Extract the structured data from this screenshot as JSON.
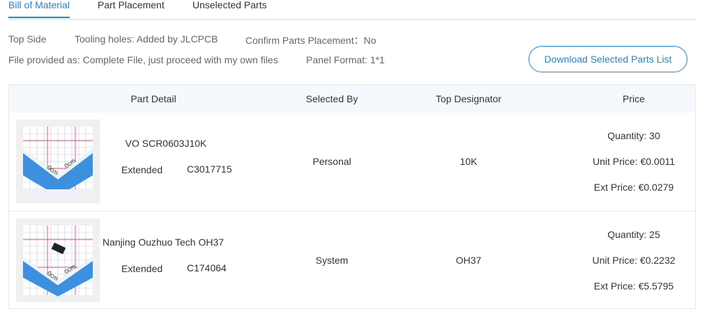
{
  "tabs": [
    {
      "label": "Bill of Material",
      "active": true
    },
    {
      "label": "Part Placement",
      "active": false
    },
    {
      "label": "Unselected Parts",
      "active": false
    }
  ],
  "info": {
    "side": "Top Side",
    "tooling": "Tooling holes: Added by JLCPCB",
    "confirm": "Confirm Parts Placement：No",
    "file": "File provided as: Complete File, just proceed with my own files",
    "panel": "Panel Format: 1*1"
  },
  "download_label": "Download Selected Parts List",
  "table": {
    "headers": [
      "Part Detail",
      "Selected By",
      "Top Designator",
      "Price"
    ],
    "rows": [
      {
        "part_name": "VO SCR0603J10K",
        "type": "Extended",
        "code": "C3017715",
        "selected_by": "Personal",
        "designator": "10K",
        "quantity": "Quantity: 30",
        "unit_price": "Unit Price: €0.0011",
        "ext_price": "Ext Price: €0.0279",
        "thumb_icon": "resistor-thumbnail-icon"
      },
      {
        "part_name": "Nanjing Ouzhuo Tech OH37",
        "type": "Extended",
        "code": "C174064",
        "selected_by": "System",
        "designator": "OH37",
        "quantity": "Quantity: 25",
        "unit_price": "Unit Price: €0.2232",
        "ext_price": "Ext Price: €5.5795",
        "thumb_icon": "sot23-thumbnail-icon"
      }
    ]
  },
  "colors": {
    "accent": "#1e87d7",
    "border": "#e8e8e8",
    "header_bg": "#f5f8fc",
    "ruler_blue": "#3d8fe0",
    "grid_red": "#e0457a"
  }
}
